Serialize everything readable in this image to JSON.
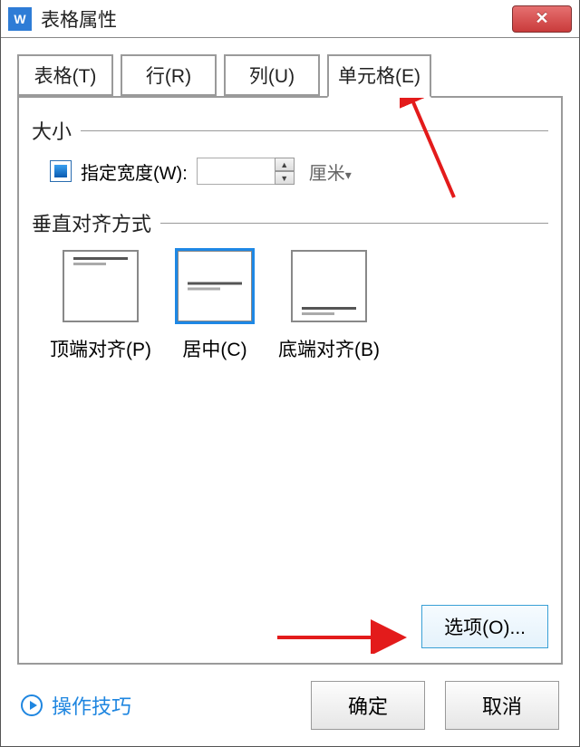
{
  "titlebar": {
    "app_icon_letter": "W",
    "title": "表格属性"
  },
  "tabs": {
    "table": "表格(T)",
    "row": "行(R)",
    "column": "列(U)",
    "cell": "单元格(E)",
    "active": "cell"
  },
  "size_group": {
    "label": "大小",
    "specify_width_label": "指定宽度(W):",
    "width_value": "",
    "unit_label": "厘米",
    "checked": true
  },
  "valign_group": {
    "label": "垂直对齐方式",
    "options": [
      {
        "key": "top",
        "label": "顶端对齐(P)",
        "selected": false
      },
      {
        "key": "center",
        "label": "居中(C)",
        "selected": true
      },
      {
        "key": "bottom",
        "label": "底端对齐(B)",
        "selected": false
      }
    ]
  },
  "options_button": "选项(O)...",
  "footer": {
    "tip": "操作技巧",
    "ok": "确定",
    "cancel": "取消"
  },
  "annotations": {
    "arrow_to_cell_tab": true,
    "arrow_to_options_button": true,
    "colors": {
      "arrow": "#e31b1b"
    }
  }
}
